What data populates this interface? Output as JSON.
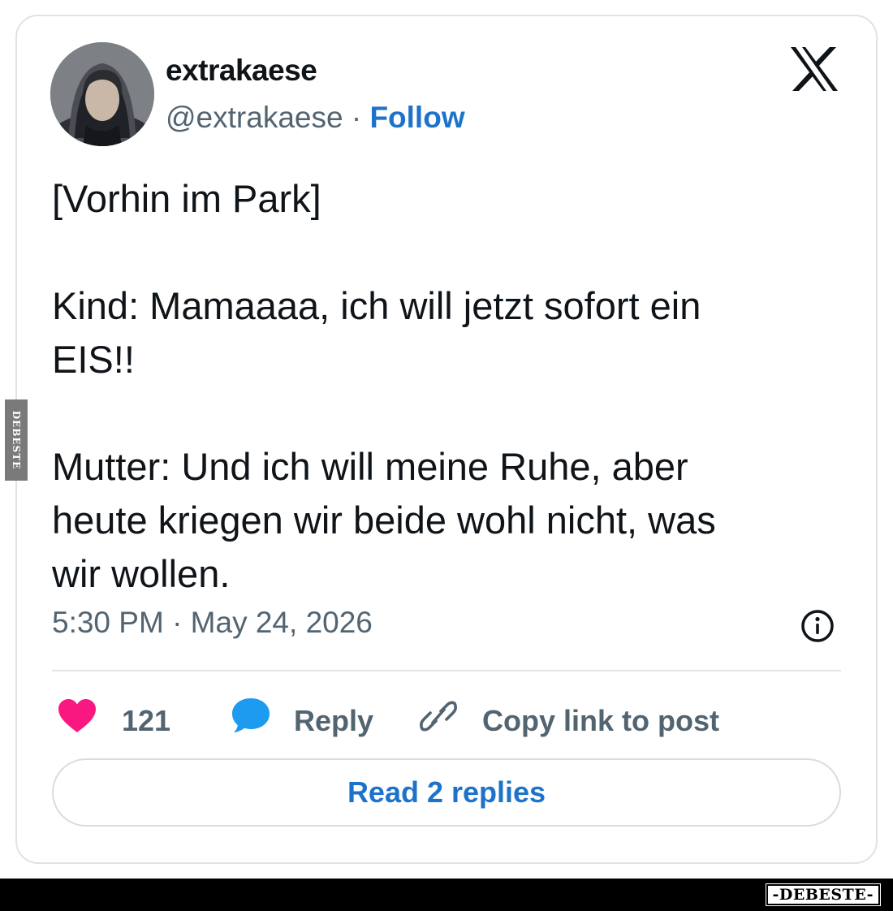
{
  "post": {
    "display_name": "extrakaese",
    "handle": "@extrakaese",
    "separator": "·",
    "follow_label": "Follow",
    "text_lines": [
      "[Vorhin im Park]",
      "",
      "Kind: Mamaaaa, ich will jetzt sofort ein",
      "EIS!!",
      "",
      "Mutter: Und ich will meine Ruhe, aber",
      "heute kriegen wir beide wohl nicht, was",
      "wir wollen."
    ],
    "timestamp": "5:30 PM · May 24, 2026"
  },
  "actions": {
    "like_count": "121",
    "reply_label": "Reply",
    "copy_link_label": "Copy link to post"
  },
  "read_replies_label": "Read 2 replies",
  "watermark": {
    "side": "DEBESTE",
    "bottom": "-DEBESTE-"
  },
  "colors": {
    "link_blue": "#1d73c9",
    "heart_pink": "#f91880",
    "bubble_blue": "#1d9bf0",
    "muted_gray": "#536471"
  },
  "icons": [
    "x-logo-icon",
    "info-icon",
    "heart-icon",
    "reply-bubble-icon",
    "link-icon"
  ]
}
